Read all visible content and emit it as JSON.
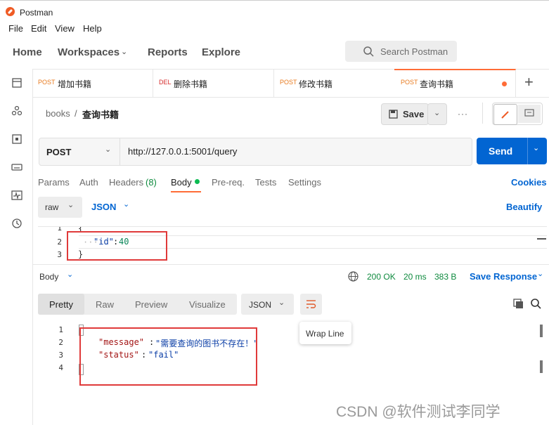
{
  "window": {
    "title": "Postman"
  },
  "menu": [
    "File",
    "Edit",
    "View",
    "Help"
  ],
  "nav": {
    "home": "Home",
    "workspaces": "Workspaces",
    "reports": "Reports",
    "explore": "Explore",
    "search_placeholder": "Search Postman"
  },
  "tabs": [
    {
      "method": "POST",
      "name": "增加书籍"
    },
    {
      "method": "DEL",
      "name": "删除书籍"
    },
    {
      "method": "POST",
      "name": "修改书籍"
    },
    {
      "method": "POST",
      "name": "查询书籍"
    }
  ],
  "breadcrumb": {
    "collection": "books",
    "separator": "/",
    "request": "查询书籍"
  },
  "toolbar": {
    "save": "Save",
    "more": "···"
  },
  "request": {
    "method": "POST",
    "url": "http://127.0.0.1:5001/query",
    "send": "Send"
  },
  "request_tabs": {
    "params": "Params",
    "auth": "Auth",
    "headers": "Headers",
    "headers_count": "(8)",
    "body": "Body",
    "prereq": "Pre-req.",
    "tests": "Tests",
    "settings": "Settings",
    "cookies": "Cookies"
  },
  "body_opts": {
    "mode": "raw",
    "format": "JSON",
    "beautify": "Beautify"
  },
  "request_body": {
    "line_numbers": [
      "1",
      "2",
      "3"
    ],
    "lines": [
      "{",
      "····\"id\":40",
      "}"
    ],
    "key": "\"id\"",
    "value": "40"
  },
  "response": {
    "label": "Body",
    "status": "200 OK",
    "time": "20 ms",
    "size": "383 B",
    "save_response": "Save Response",
    "views": [
      "Pretty",
      "Raw",
      "Preview",
      "Visualize"
    ],
    "format": "JSON",
    "tooltip": "Wrap Line",
    "line_numbers": [
      "1",
      "2",
      "3",
      "4"
    ],
    "message_key": "\"message\"",
    "message_value": "\"需要查询的图书不存在！\"",
    "status_key": "\"status\"",
    "status_value": "\"fail\""
  },
  "watermark": "CSDN @软件测试李同学",
  "colors": {
    "accent": "#ff6c37",
    "send": "#0265d2",
    "status_ok": "#0e8a3e",
    "highlight_box": "#e03a3a"
  }
}
